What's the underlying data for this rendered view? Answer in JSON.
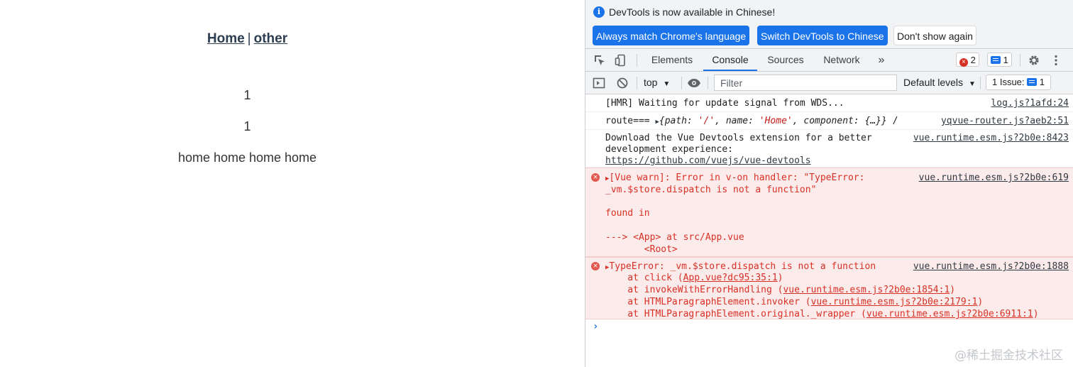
{
  "app": {
    "nav": {
      "home": "Home",
      "separator": "|",
      "other": "other"
    },
    "lines": [
      "1",
      "1",
      "home home home home"
    ]
  },
  "devtools": {
    "infobar": {
      "message": "DevTools is now available in Chinese!",
      "buttons": [
        "Always match Chrome's language",
        "Switch DevTools to Chinese",
        "Don't show again"
      ]
    },
    "tabs": [
      "Elements",
      "Console",
      "Sources",
      "Network"
    ],
    "more_tabs": "»",
    "active_tab": "Console",
    "error_count": "2",
    "message_count": "1",
    "toolbar": {
      "context": "top",
      "filter_placeholder": "Filter",
      "levels": "Default levels",
      "issues_label": "1 Issue:",
      "issues_count": "1"
    },
    "console": {
      "hmr": {
        "text": "[HMR] Waiting for update signal from WDS...",
        "source": "log.js?1afd:24"
      },
      "route": {
        "prefix": "route=== ",
        "k_path": "path",
        "v_path": "'/'",
        "k_name": "name",
        "v_name": "'Home'",
        "k_component": "component",
        "v_component": "{…}}",
        "suffix": " /",
        "source": "yqvue-router.js?aeb2:51"
      },
      "devtools_hint": {
        "line1": "Download the Vue Devtools extension for a better",
        "line2": "development experience:",
        "link": "https://github.com/vuejs/vue-devtools",
        "source": "vue.runtime.esm.js?2b0e:8423"
      },
      "warn": {
        "line1": "[Vue warn]: Error in v-on handler: \"TypeError:",
        "line2": "_vm.$store.dispatch is not a function\"",
        "line3": "found in",
        "line4": "---> <App> at src/App.vue",
        "line5": "       <Root>",
        "source": "vue.runtime.esm.js?2b0e:619"
      },
      "type_error": {
        "line1": "TypeError: _vm.$store.dispatch is not a function",
        "at": "    at ",
        "frames": [
          {
            "fn": "click (",
            "loc": "App.vue?dc95:35:1",
            "end": ")"
          },
          {
            "fn": "invokeWithErrorHandling (",
            "loc": "vue.runtime.esm.js?2b0e:1854:1",
            "end": ")"
          },
          {
            "fn": "HTMLParagraphElement.invoker (",
            "loc": "vue.runtime.esm.js?2b0e:2179:1",
            "end": ")"
          },
          {
            "fn": "HTMLParagraphElement.original._wrapper (",
            "loc": "vue.runtime.esm.js?2b0e:6911:1",
            "end": ")"
          }
        ],
        "source": "vue.runtime.esm.js?2b0e:1888"
      },
      "prompt": "›"
    },
    "watermark": "@稀土掘金技术社区"
  }
}
